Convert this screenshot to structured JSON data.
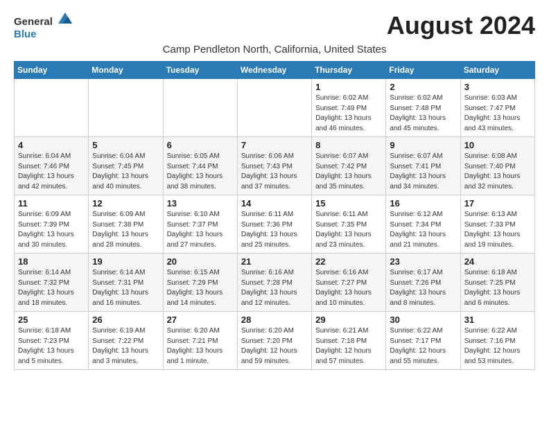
{
  "header": {
    "logo_general": "General",
    "logo_blue": "Blue",
    "month_title": "August 2024",
    "location": "Camp Pendleton North, California, United States"
  },
  "weekdays": [
    "Sunday",
    "Monday",
    "Tuesday",
    "Wednesday",
    "Thursday",
    "Friday",
    "Saturday"
  ],
  "weeks": [
    [
      {
        "day": "",
        "sunrise": "",
        "sunset": "",
        "daylight": ""
      },
      {
        "day": "",
        "sunrise": "",
        "sunset": "",
        "daylight": ""
      },
      {
        "day": "",
        "sunrise": "",
        "sunset": "",
        "daylight": ""
      },
      {
        "day": "",
        "sunrise": "",
        "sunset": "",
        "daylight": ""
      },
      {
        "day": "1",
        "sunrise": "Sunrise: 6:02 AM",
        "sunset": "Sunset: 7:49 PM",
        "daylight": "Daylight: 13 hours and 46 minutes."
      },
      {
        "day": "2",
        "sunrise": "Sunrise: 6:02 AM",
        "sunset": "Sunset: 7:48 PM",
        "daylight": "Daylight: 13 hours and 45 minutes."
      },
      {
        "day": "3",
        "sunrise": "Sunrise: 6:03 AM",
        "sunset": "Sunset: 7:47 PM",
        "daylight": "Daylight: 13 hours and 43 minutes."
      }
    ],
    [
      {
        "day": "4",
        "sunrise": "Sunrise: 6:04 AM",
        "sunset": "Sunset: 7:46 PM",
        "daylight": "Daylight: 13 hours and 42 minutes."
      },
      {
        "day": "5",
        "sunrise": "Sunrise: 6:04 AM",
        "sunset": "Sunset: 7:45 PM",
        "daylight": "Daylight: 13 hours and 40 minutes."
      },
      {
        "day": "6",
        "sunrise": "Sunrise: 6:05 AM",
        "sunset": "Sunset: 7:44 PM",
        "daylight": "Daylight: 13 hours and 38 minutes."
      },
      {
        "day": "7",
        "sunrise": "Sunrise: 6:06 AM",
        "sunset": "Sunset: 7:43 PM",
        "daylight": "Daylight: 13 hours and 37 minutes."
      },
      {
        "day": "8",
        "sunrise": "Sunrise: 6:07 AM",
        "sunset": "Sunset: 7:42 PM",
        "daylight": "Daylight: 13 hours and 35 minutes."
      },
      {
        "day": "9",
        "sunrise": "Sunrise: 6:07 AM",
        "sunset": "Sunset: 7:41 PM",
        "daylight": "Daylight: 13 hours and 34 minutes."
      },
      {
        "day": "10",
        "sunrise": "Sunrise: 6:08 AM",
        "sunset": "Sunset: 7:40 PM",
        "daylight": "Daylight: 13 hours and 32 minutes."
      }
    ],
    [
      {
        "day": "11",
        "sunrise": "Sunrise: 6:09 AM",
        "sunset": "Sunset: 7:39 PM",
        "daylight": "Daylight: 13 hours and 30 minutes."
      },
      {
        "day": "12",
        "sunrise": "Sunrise: 6:09 AM",
        "sunset": "Sunset: 7:38 PM",
        "daylight": "Daylight: 13 hours and 28 minutes."
      },
      {
        "day": "13",
        "sunrise": "Sunrise: 6:10 AM",
        "sunset": "Sunset: 7:37 PM",
        "daylight": "Daylight: 13 hours and 27 minutes."
      },
      {
        "day": "14",
        "sunrise": "Sunrise: 6:11 AM",
        "sunset": "Sunset: 7:36 PM",
        "daylight": "Daylight: 13 hours and 25 minutes."
      },
      {
        "day": "15",
        "sunrise": "Sunrise: 6:11 AM",
        "sunset": "Sunset: 7:35 PM",
        "daylight": "Daylight: 13 hours and 23 minutes."
      },
      {
        "day": "16",
        "sunrise": "Sunrise: 6:12 AM",
        "sunset": "Sunset: 7:34 PM",
        "daylight": "Daylight: 13 hours and 21 minutes."
      },
      {
        "day": "17",
        "sunrise": "Sunrise: 6:13 AM",
        "sunset": "Sunset: 7:33 PM",
        "daylight": "Daylight: 13 hours and 19 minutes."
      }
    ],
    [
      {
        "day": "18",
        "sunrise": "Sunrise: 6:14 AM",
        "sunset": "Sunset: 7:32 PM",
        "daylight": "Daylight: 13 hours and 18 minutes."
      },
      {
        "day": "19",
        "sunrise": "Sunrise: 6:14 AM",
        "sunset": "Sunset: 7:31 PM",
        "daylight": "Daylight: 13 hours and 16 minutes."
      },
      {
        "day": "20",
        "sunrise": "Sunrise: 6:15 AM",
        "sunset": "Sunset: 7:29 PM",
        "daylight": "Daylight: 13 hours and 14 minutes."
      },
      {
        "day": "21",
        "sunrise": "Sunrise: 6:16 AM",
        "sunset": "Sunset: 7:28 PM",
        "daylight": "Daylight: 13 hours and 12 minutes."
      },
      {
        "day": "22",
        "sunrise": "Sunrise: 6:16 AM",
        "sunset": "Sunset: 7:27 PM",
        "daylight": "Daylight: 13 hours and 10 minutes."
      },
      {
        "day": "23",
        "sunrise": "Sunrise: 6:17 AM",
        "sunset": "Sunset: 7:26 PM",
        "daylight": "Daylight: 13 hours and 8 minutes."
      },
      {
        "day": "24",
        "sunrise": "Sunrise: 6:18 AM",
        "sunset": "Sunset: 7:25 PM",
        "daylight": "Daylight: 13 hours and 6 minutes."
      }
    ],
    [
      {
        "day": "25",
        "sunrise": "Sunrise: 6:18 AM",
        "sunset": "Sunset: 7:23 PM",
        "daylight": "Daylight: 13 hours and 5 minutes."
      },
      {
        "day": "26",
        "sunrise": "Sunrise: 6:19 AM",
        "sunset": "Sunset: 7:22 PM",
        "daylight": "Daylight: 13 hours and 3 minutes."
      },
      {
        "day": "27",
        "sunrise": "Sunrise: 6:20 AM",
        "sunset": "Sunset: 7:21 PM",
        "daylight": "Daylight: 13 hours and 1 minute."
      },
      {
        "day": "28",
        "sunrise": "Sunrise: 6:20 AM",
        "sunset": "Sunset: 7:20 PM",
        "daylight": "Daylight: 12 hours and 59 minutes."
      },
      {
        "day": "29",
        "sunrise": "Sunrise: 6:21 AM",
        "sunset": "Sunset: 7:18 PM",
        "daylight": "Daylight: 12 hours and 57 minutes."
      },
      {
        "day": "30",
        "sunrise": "Sunrise: 6:22 AM",
        "sunset": "Sunset: 7:17 PM",
        "daylight": "Daylight: 12 hours and 55 minutes."
      },
      {
        "day": "31",
        "sunrise": "Sunrise: 6:22 AM",
        "sunset": "Sunset: 7:16 PM",
        "daylight": "Daylight: 12 hours and 53 minutes."
      }
    ]
  ]
}
